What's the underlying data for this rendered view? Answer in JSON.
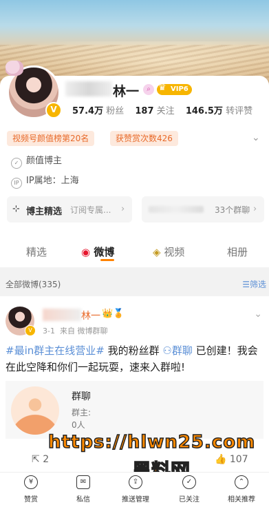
{
  "profile": {
    "name": "林一",
    "vip_label": "VIP6",
    "stats": [
      {
        "value": "57.4万",
        "label": "粉丝"
      },
      {
        "value": "187",
        "label": "关注"
      },
      {
        "value": "146.5万",
        "label": "转评赞"
      }
    ],
    "badges": [
      "视频号颜值榜第20名",
      "获赞赏次数426"
    ],
    "category": "颜值博主",
    "ip": "IP属地：上海",
    "featured_label": "博主精选",
    "featured_sub": "订阅专属...",
    "groups_label": "33个群聊"
  },
  "tabs": [
    {
      "label": "精选"
    },
    {
      "label": "微博"
    },
    {
      "label": "视频"
    },
    {
      "label": "相册"
    }
  ],
  "feed_header": {
    "all_label": "全部微博(335)",
    "filter_label": "筛选"
  },
  "post": {
    "author": "林一",
    "date": "3-1",
    "source": "来自 微博群聊",
    "text_link": "#最in群主在线营业#",
    "text_mid": " 我的粉丝群 ",
    "group_link": "群聊",
    "text_end": " 已创建！我会在此空降和你们一起玩耍，速来入群啦!",
    "group_card": {
      "title": "群聊",
      "owner": "群主:",
      "count": "0人"
    },
    "repost_count": "2",
    "like_count": "107"
  },
  "watermark": {
    "url": "https://hlwn25.com",
    "name": "黑料网"
  },
  "bottom_bar": [
    {
      "label": "赞赏",
      "icon": "yen-icon"
    },
    {
      "label": "私信",
      "icon": "message-icon"
    },
    {
      "label": "推送管理",
      "icon": "push-icon"
    },
    {
      "label": "已关注",
      "icon": "check-icon"
    },
    {
      "label": "相关推荐",
      "icon": "recommend-icon"
    }
  ]
}
